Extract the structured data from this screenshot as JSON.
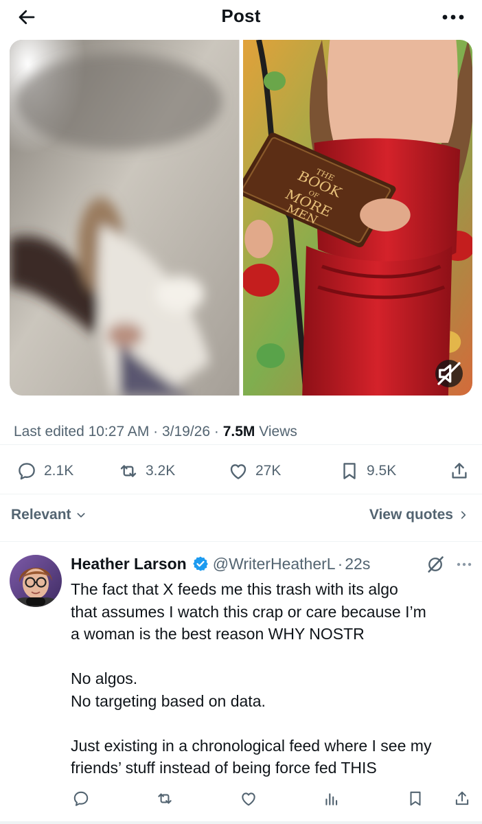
{
  "header": {
    "title": "Post",
    "back_icon": "arrow-left-icon",
    "more_icon": "more-horizontal-icon"
  },
  "media": {
    "left_image": "blurred-photo-woman-falling",
    "right_image": "woman-red-dress-holding-book",
    "book_cover_text": [
      "THE",
      "BOOK",
      "OF",
      "MORE",
      "MEN"
    ],
    "mute_icon": "speaker-muted-icon"
  },
  "post_meta": {
    "edited_label": "Last edited 10:27 AM · 3/19/26 · ",
    "views_count": "7.5M",
    "views_label": " Views"
  },
  "post_actions": {
    "replies": "2.1K",
    "reposts": "3.2K",
    "likes": "27K",
    "bookmarks": "9.5K"
  },
  "sort": {
    "relevant_label": "Relevant",
    "view_quotes_label": "View quotes"
  },
  "reply": {
    "author_name": "Heather Larson",
    "handle": "@WriterHeatherL",
    "separator": "·",
    "time": "22s",
    "lines": [
      "The fact that X feeds me this trash with its algo",
      "that assumes I watch this crap or care because I’m",
      "a woman is the best reason WHY NOSTR",
      "",
      "No algos.",
      "No targeting based on data.",
      "",
      "Just existing in a chronological feed where I see my",
      "friends’ stuff instead of being force fed THIS"
    ]
  },
  "colors": {
    "text_primary": "#0f1419",
    "text_secondary": "#536471",
    "verified_blue": "#1d9bf0",
    "divider": "#eff3f4"
  }
}
